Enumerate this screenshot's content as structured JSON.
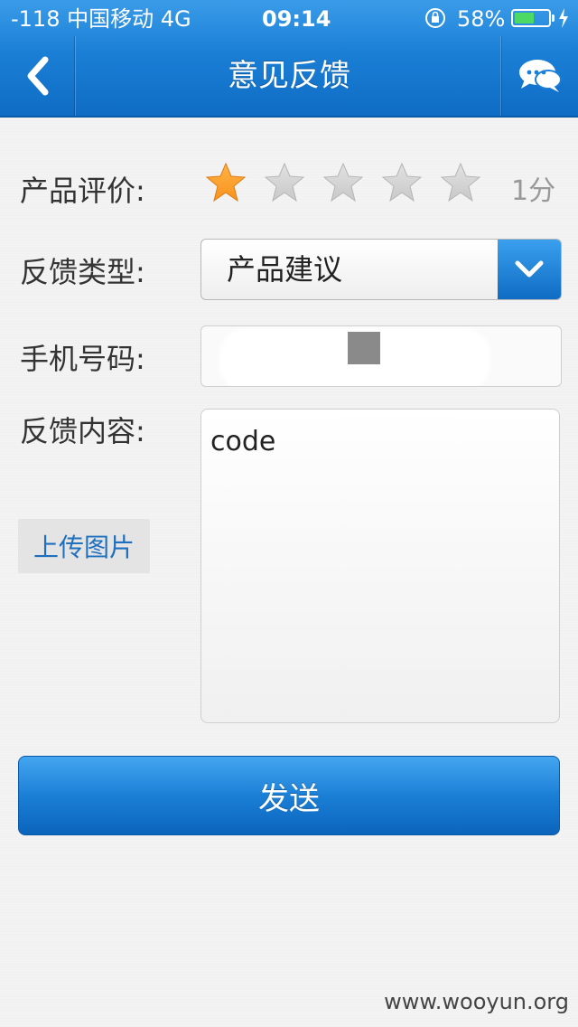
{
  "status_bar": {
    "carrier": "-118 中国移动  4G",
    "time": "09:14",
    "battery_percent": "58%",
    "battery_level": 0.58,
    "battery_color": "#4cd964"
  },
  "nav": {
    "title": "意见反馈",
    "back_icon": "chevron-left-icon",
    "chat_icon": "chat-bubbles-icon"
  },
  "form": {
    "rating": {
      "label": "产品评价:",
      "value": 1,
      "max": 5,
      "score_text": "1分",
      "active_color": "#f7931e",
      "inactive_color": "#c8c8c8"
    },
    "feedback_type": {
      "label": "反馈类型:",
      "selected": "产品建议"
    },
    "phone": {
      "label": "手机号码:"
    },
    "content": {
      "label": "反馈内容:",
      "value": "code"
    },
    "upload_label": "上传图片",
    "send_label": "发送"
  },
  "watermark": "www.wooyun.org",
  "colors": {
    "accent": "#1b7fd6"
  }
}
